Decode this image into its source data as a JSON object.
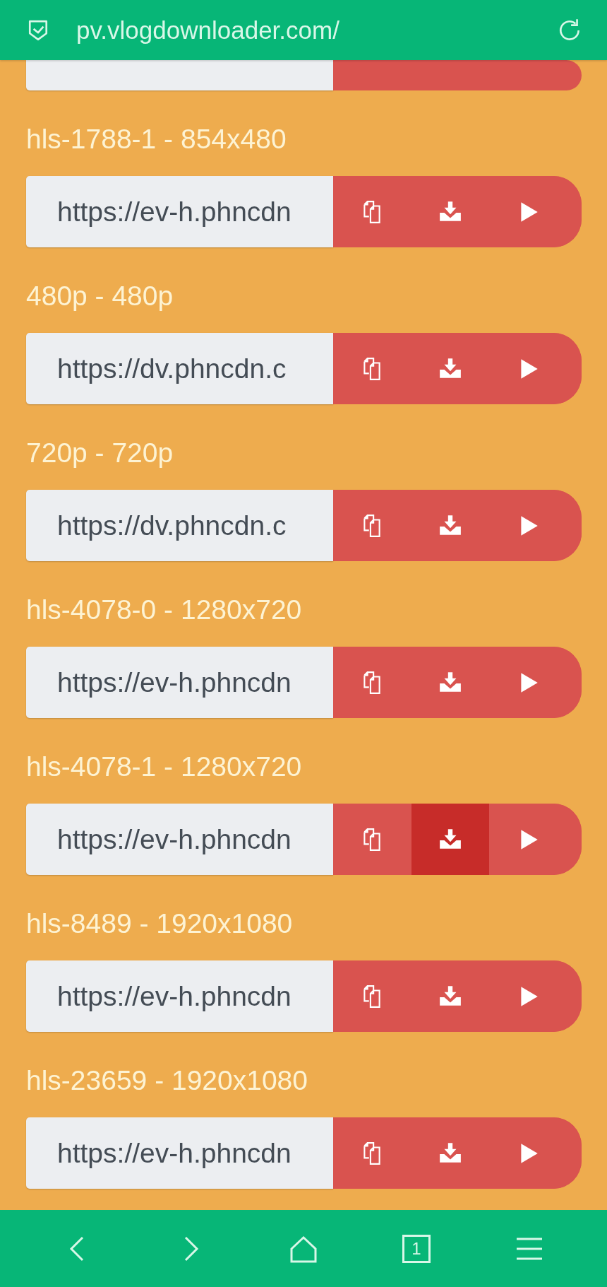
{
  "address_bar": {
    "url": "pv.vlogdownloader.com/"
  },
  "top_cut_row": {
    "kind": "url-row"
  },
  "streams": [
    {
      "label": "hls-1788-1 - 854x480",
      "url": "https://ev-h.phncdn",
      "buttons": [
        {
          "kind": "copy",
          "pressed": false
        },
        {
          "kind": "download",
          "pressed": false
        },
        {
          "kind": "play",
          "pressed": false
        }
      ]
    },
    {
      "label": "480p - 480p",
      "url": "https://dv.phncdn.c",
      "buttons": [
        {
          "kind": "copy",
          "pressed": false
        },
        {
          "kind": "download",
          "pressed": false
        },
        {
          "kind": "play",
          "pressed": false
        }
      ]
    },
    {
      "label": "720p - 720p",
      "url": "https://dv.phncdn.c",
      "buttons": [
        {
          "kind": "copy",
          "pressed": false
        },
        {
          "kind": "download",
          "pressed": false
        },
        {
          "kind": "play",
          "pressed": false
        }
      ]
    },
    {
      "label": "hls-4078-0 - 1280x720",
      "url": "https://ev-h.phncdn",
      "buttons": [
        {
          "kind": "copy",
          "pressed": false
        },
        {
          "kind": "download",
          "pressed": false
        },
        {
          "kind": "play",
          "pressed": false
        }
      ]
    },
    {
      "label": "hls-4078-1 - 1280x720",
      "url": "https://ev-h.phncdn",
      "buttons": [
        {
          "kind": "copy",
          "pressed": false
        },
        {
          "kind": "download",
          "pressed": true
        },
        {
          "kind": "play",
          "pressed": false
        }
      ]
    },
    {
      "label": "hls-8489 - 1920x1080",
      "url": "https://ev-h.phncdn",
      "buttons": [
        {
          "kind": "copy",
          "pressed": false
        },
        {
          "kind": "download",
          "pressed": false
        },
        {
          "kind": "play",
          "pressed": false
        }
      ]
    },
    {
      "label": "hls-23659 - 1920x1080",
      "url": "https://ev-h.phncdn",
      "buttons": [
        {
          "kind": "copy",
          "pressed": false
        },
        {
          "kind": "download",
          "pressed": false
        },
        {
          "kind": "play",
          "pressed": false
        }
      ]
    }
  ],
  "bottom_bar": {
    "tab_count": "1"
  }
}
